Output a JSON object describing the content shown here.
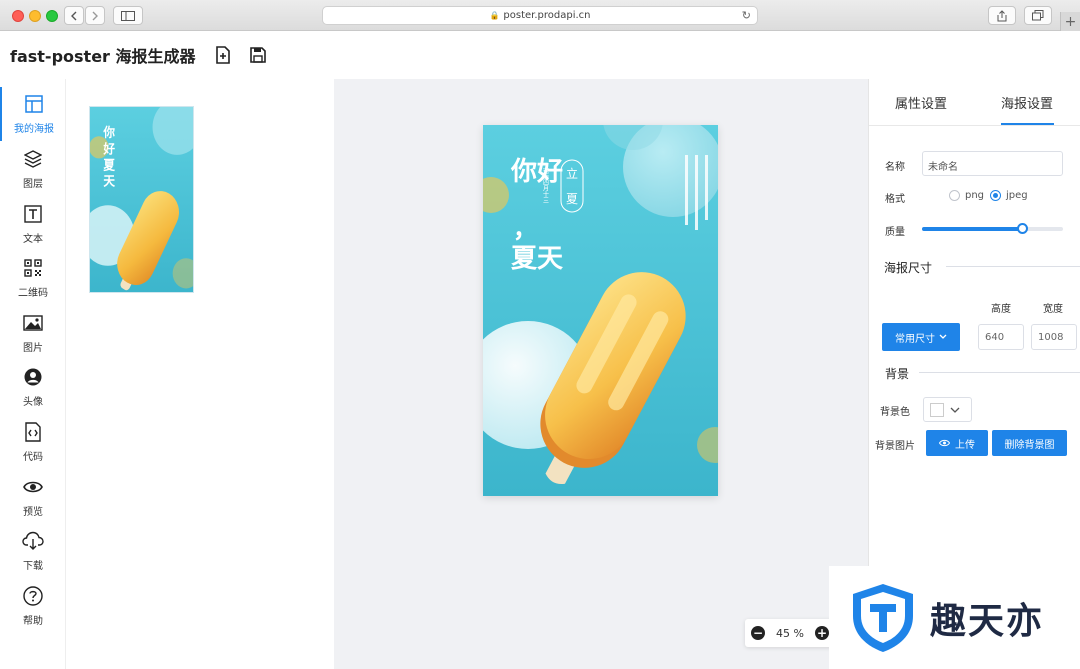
{
  "browser": {
    "url": "poster.prodapi.cn"
  },
  "app": {
    "title": "fast-poster 海报生成器"
  },
  "toolbar": {
    "items": [
      {
        "label": "我的海报",
        "icon": "layout-icon",
        "active": true
      },
      {
        "label": "图层",
        "icon": "layers-icon"
      },
      {
        "label": "文本",
        "icon": "text-icon"
      },
      {
        "label": "二维码",
        "icon": "qrcode-icon"
      },
      {
        "label": "图片",
        "icon": "image-icon"
      },
      {
        "label": "头像",
        "icon": "avatar-icon"
      },
      {
        "label": "代码",
        "icon": "code-icon"
      },
      {
        "label": "预览",
        "icon": "eye-icon"
      },
      {
        "label": "下载",
        "icon": "cloud-download-icon"
      },
      {
        "label": "帮助",
        "icon": "help-icon"
      }
    ]
  },
  "poster": {
    "headline_1": "你好",
    "headline_comma": "，",
    "headline_2": "夏天",
    "seal_1": "立",
    "seal_2": "夏",
    "lunar_1": "农历四月十三",
    "colors": {
      "sky_top": "#5ccfe0",
      "sky_bottom": "#3cb5cc",
      "popsicle": "#f7c84a",
      "stick": "#f3e2c1"
    }
  },
  "zoom": {
    "value": "45 %"
  },
  "right_panel": {
    "tabs": [
      {
        "label": "属性设置",
        "active": false
      },
      {
        "label": "海报设置",
        "active": true
      }
    ],
    "name_label": "名称",
    "name_value": "未命名",
    "format_label": "格式",
    "format_options": [
      "png",
      "jpeg"
    ],
    "format_selected": "jpeg",
    "quality_label": "质量",
    "quality_value": 0.71,
    "size_section": "海报尺寸",
    "height_label": "高度",
    "width_label": "宽度",
    "preset_button": "常用尺寸",
    "height_value": "640",
    "width_value": "1008",
    "background_section": "背景",
    "bg_color_label": "背景色",
    "bg_color_value": "#ffffff",
    "bg_image_label": "背景图片",
    "upload_button": "上传",
    "delete_bg_button": "删除背景图"
  },
  "watermark": {
    "text": "趣天亦",
    "colors": {
      "shield": "#1f84e8"
    }
  }
}
